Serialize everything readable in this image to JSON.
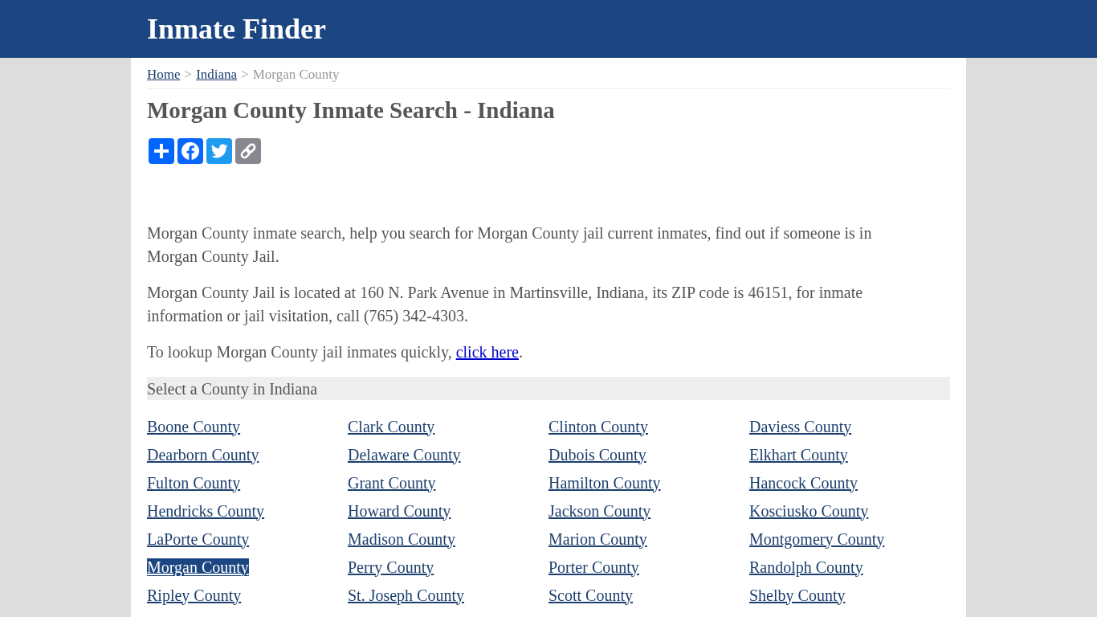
{
  "header": {
    "title": "Inmate Finder"
  },
  "breadcrumb": {
    "items": [
      {
        "label": "Home",
        "kind": "link"
      },
      {
        "label": "Indiana",
        "kind": "link"
      },
      {
        "label": "Morgan County",
        "kind": "current"
      }
    ],
    "separators": [
      ">",
      ">"
    ]
  },
  "heading": "Morgan County Inmate Search - Indiana",
  "paragraphs": [
    [
      {
        "kind": "text",
        "text": "Morgan County inmate search, help you search for Morgan County jail current inmates, find out if someone is in Morgan County Jail."
      }
    ],
    [
      {
        "kind": "text",
        "text": "Morgan County Jail is located at 160 N. Park Avenue in Martinsville, Indiana, its ZIP code is 46151, for inmate information or jail visitation, call (765) 342-4303."
      }
    ],
    [
      {
        "kind": "text",
        "text": "To lookup Morgan County jail inmates quickly, "
      },
      {
        "kind": "link",
        "text": "click here"
      },
      {
        "kind": "text",
        "text": "."
      }
    ]
  ],
  "county_section": {
    "title": "Select a County in Indiana",
    "counties": [
      {
        "name": "Boone County",
        "selected": false
      },
      {
        "name": "Clark County",
        "selected": false
      },
      {
        "name": "Clinton County",
        "selected": false
      },
      {
        "name": "Daviess County",
        "selected": false
      },
      {
        "name": "Dearborn County",
        "selected": false
      },
      {
        "name": "Delaware County",
        "selected": false
      },
      {
        "name": "Dubois County",
        "selected": false
      },
      {
        "name": "Elkhart County",
        "selected": false
      },
      {
        "name": "Fulton County",
        "selected": false
      },
      {
        "name": "Grant County",
        "selected": false
      },
      {
        "name": "Hamilton County",
        "selected": false
      },
      {
        "name": "Hancock County",
        "selected": false
      },
      {
        "name": "Hendricks County",
        "selected": false
      },
      {
        "name": "Howard County",
        "selected": false
      },
      {
        "name": "Jackson County",
        "selected": false
      },
      {
        "name": "Kosciusko County",
        "selected": false
      },
      {
        "name": "LaPorte County",
        "selected": false
      },
      {
        "name": "Madison County",
        "selected": false
      },
      {
        "name": "Marion County",
        "selected": false
      },
      {
        "name": "Montgomery County",
        "selected": false
      },
      {
        "name": "Morgan County",
        "selected": true
      },
      {
        "name": "Perry County",
        "selected": false
      },
      {
        "name": "Porter County",
        "selected": false
      },
      {
        "name": "Randolph County",
        "selected": false
      },
      {
        "name": "Ripley County",
        "selected": false
      },
      {
        "name": "St. Joseph County",
        "selected": false
      },
      {
        "name": "Scott County",
        "selected": false
      },
      {
        "name": "Shelby County",
        "selected": false
      }
    ]
  }
}
